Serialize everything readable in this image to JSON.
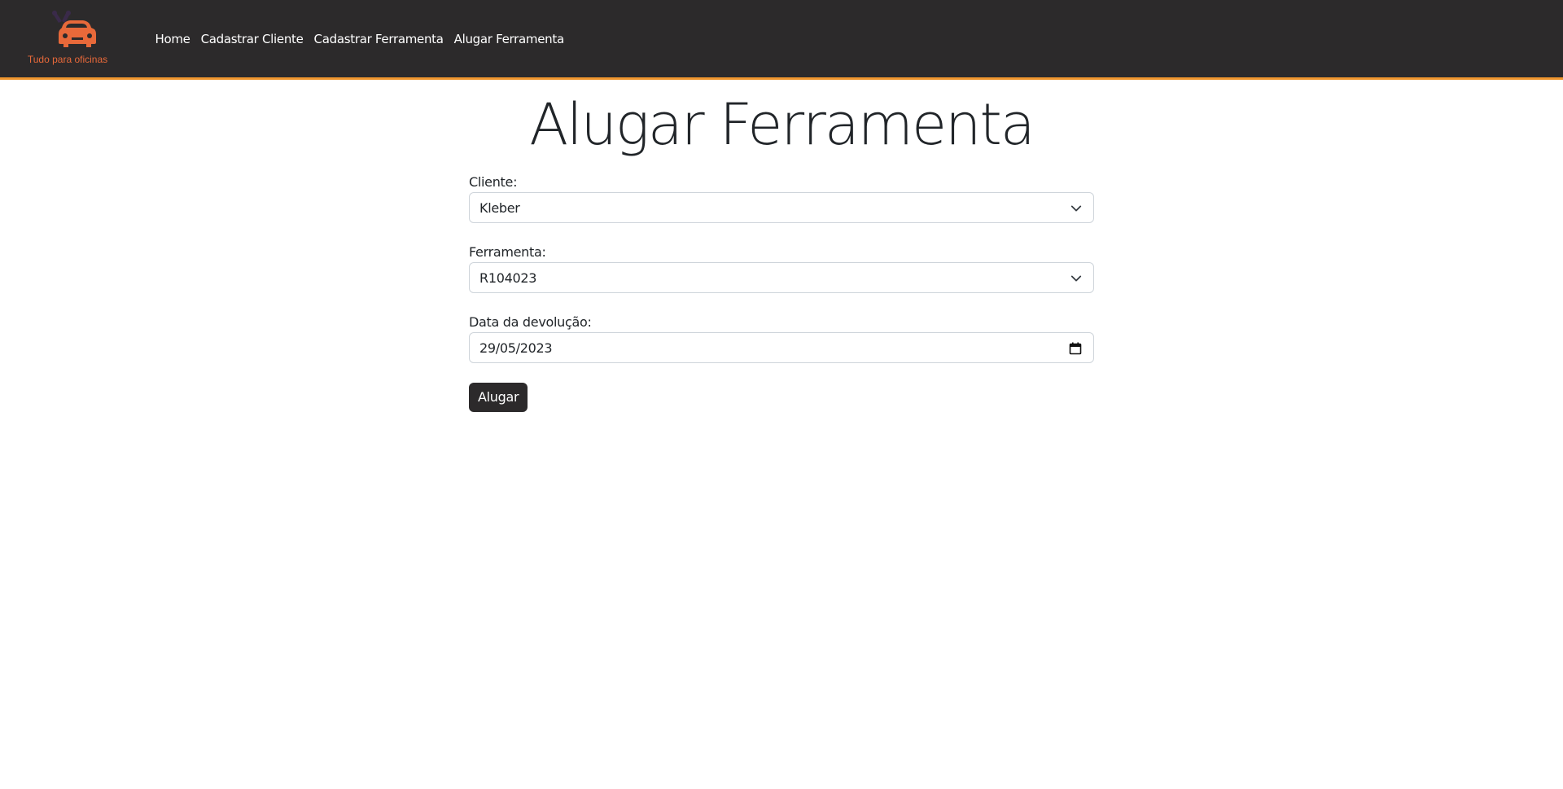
{
  "navbar": {
    "brand_tagline": "Tudo para oficinas",
    "links": [
      {
        "label": "Home"
      },
      {
        "label": "Cadastrar Cliente"
      },
      {
        "label": "Cadastrar Ferramenta"
      },
      {
        "label": "Alugar Ferramenta"
      }
    ],
    "colors": {
      "background": "#2c2a2b",
      "accent_border": "#f0962e",
      "brand_orange": "#e8693a"
    }
  },
  "page": {
    "title": "Alugar Ferramenta"
  },
  "form": {
    "cliente": {
      "label": "Cliente:",
      "value": "Kleber"
    },
    "ferramenta": {
      "label": "Ferramenta:",
      "value": "R104023"
    },
    "data_devolucao": {
      "label": "Data da devolução:",
      "value": "29/05/2023"
    },
    "submit_label": "Alugar"
  },
  "icons": {
    "logo": "car-tools-logo-icon",
    "select": "chevron-down-icon",
    "date": "calendar-icon"
  }
}
